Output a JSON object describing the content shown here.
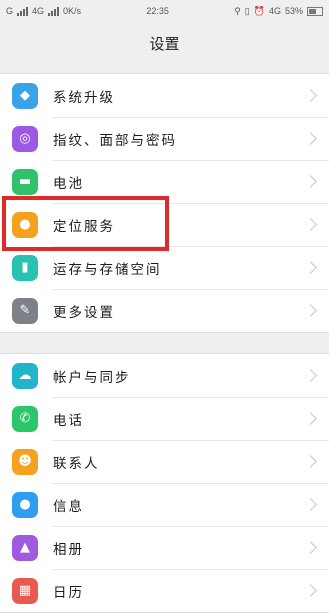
{
  "status": {
    "carrier_left": "G",
    "network": "4G",
    "speed": "0K/s",
    "time": "22:35",
    "network_right": "4G",
    "battery": "53%"
  },
  "title": "设置",
  "groups": [
    [
      {
        "label": "系统升级",
        "icon": "system-update-icon",
        "color": "#3aa3e8"
      },
      {
        "label": "指纹、面部与密码",
        "icon": "fingerprint-icon",
        "color": "#9b59e6"
      },
      {
        "label": "电池",
        "icon": "battery-icon",
        "color": "#2fc26b"
      },
      {
        "label": "定位服务",
        "icon": "location-icon",
        "color": "#f5a11e"
      },
      {
        "label": "运存与存储空间",
        "icon": "storage-icon",
        "color": "#27c3b0"
      },
      {
        "label": "更多设置",
        "icon": "wrench-icon",
        "color": "#7d8288"
      }
    ],
    [
      {
        "label": "帐户与同步",
        "icon": "account-sync-icon",
        "color": "#22b5c9"
      },
      {
        "label": "电话",
        "icon": "phone-icon",
        "color": "#2bc66a"
      },
      {
        "label": "联系人",
        "icon": "contacts-icon",
        "color": "#f4a321"
      },
      {
        "label": "信息",
        "icon": "message-icon",
        "color": "#2f9ef0"
      },
      {
        "label": "相册",
        "icon": "gallery-icon",
        "color": "#a05ae0"
      },
      {
        "label": "日历",
        "icon": "calendar-icon",
        "color": "#e85a4f"
      }
    ]
  ],
  "highlight_color": "#e02a2a"
}
